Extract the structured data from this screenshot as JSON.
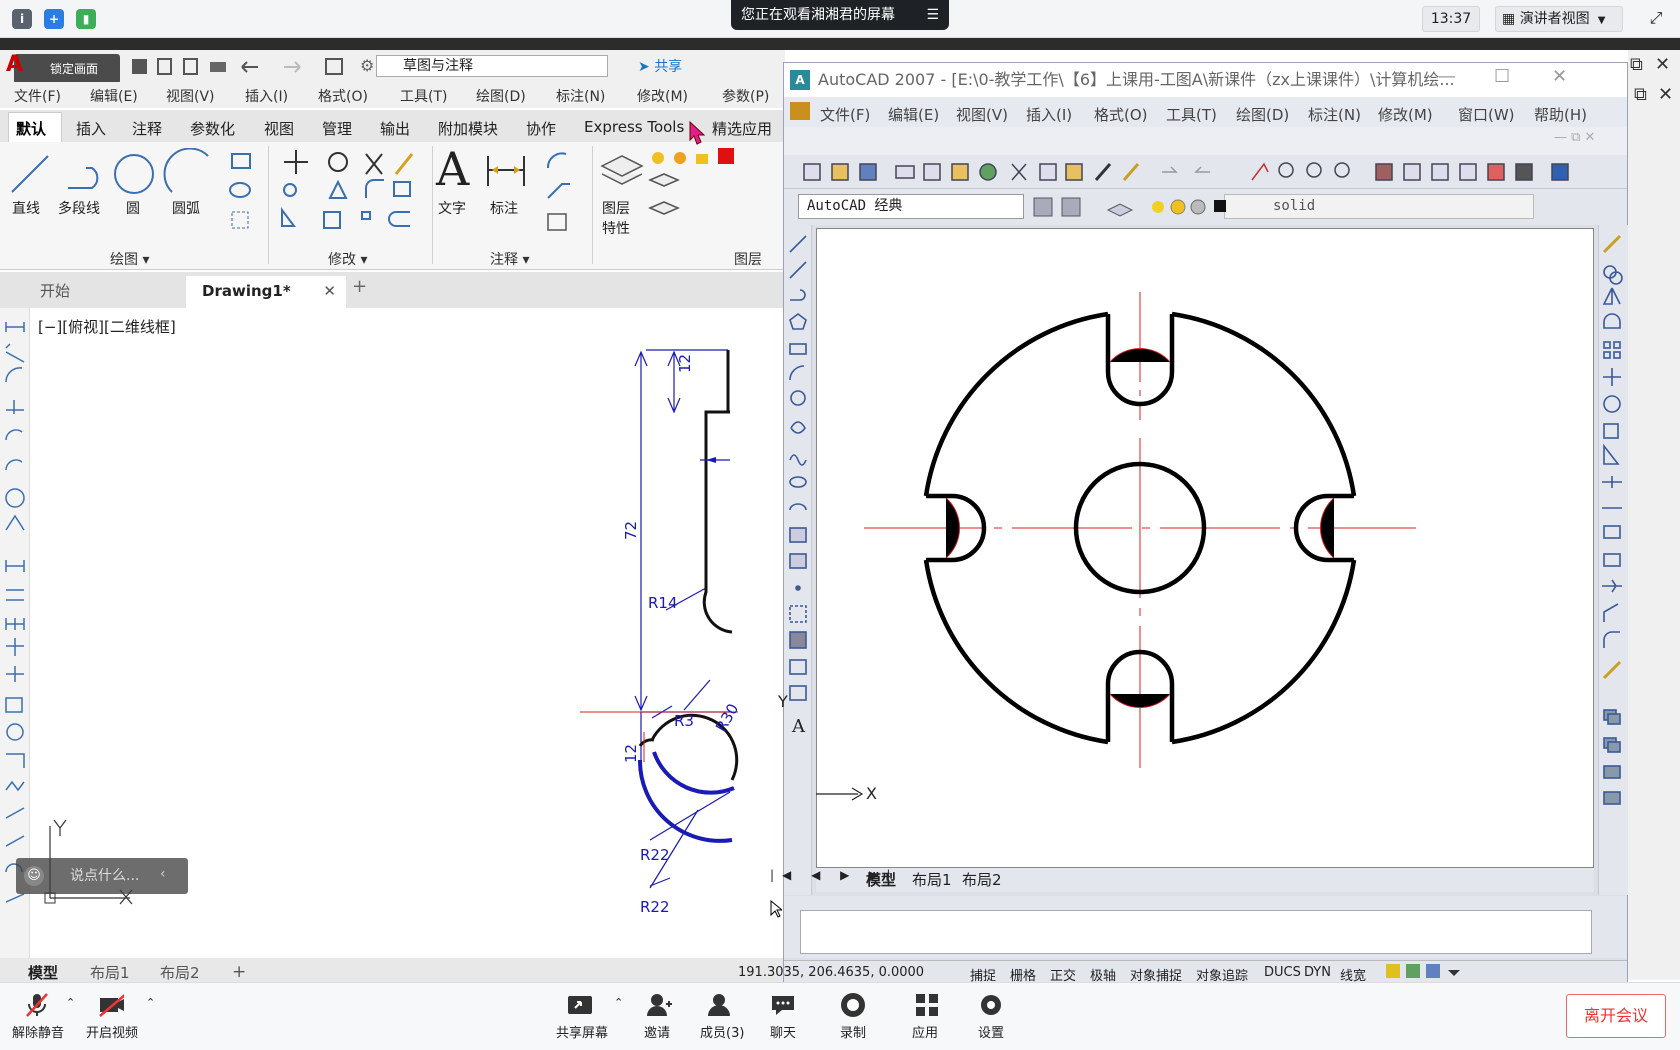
{
  "meeting": {
    "banner": "您正在观看湘湘君的屏幕",
    "clock": "13:37",
    "presenter_view": "演讲者视图",
    "lock_screen": "锁定画面",
    "chat_placeholder": "说点什么...",
    "bottom": {
      "unmute": "解除静音",
      "start_video": "开启视频",
      "share_screen": "共享屏幕",
      "invite": "邀请",
      "members": "成员(3)",
      "chat": "聊天",
      "record": "录制",
      "apps": "应用",
      "settings": "设置",
      "leave": "离开会议"
    }
  },
  "acad_left": {
    "workspace": "草图与注释",
    "share": "共享",
    "menu": [
      "文件(F)",
      "编辑(E)",
      "视图(V)",
      "插入(I)",
      "格式(O)",
      "工具(T)",
      "绘图(D)",
      "标注(N)",
      "修改(M)",
      "参数(P)"
    ],
    "ribbon_tabs": [
      "默认",
      "插入",
      "注释",
      "参数化",
      "视图",
      "管理",
      "输出",
      "附加模块",
      "协作",
      "Express Tools",
      "精选应用"
    ],
    "tools": {
      "line": "直线",
      "polyline": "多段线",
      "circle": "圆",
      "arc": "圆弧",
      "text": "文字",
      "dim": "标注",
      "layer": "图层",
      "props": "特性"
    },
    "panels": {
      "draw": "绘图",
      "modify": "修改",
      "annotate": "注释",
      "layer": "图层"
    },
    "doc_tabs": {
      "start": "开始",
      "drawing": "Drawing1*"
    },
    "view_label": "[−][俯视][二维线框]",
    "layout_tabs": [
      "模型",
      "布局1",
      "布局2"
    ],
    "dims": {
      "d12a": "12",
      "d72": "72",
      "d12b": "12",
      "r14": "R14",
      "r3": "R3",
      "r30": "R30",
      "r22a": "R22",
      "r22b": "R22"
    }
  },
  "acad_right": {
    "title": "AutoCAD 2007 - [E:\\0-教学工作\\【6】上课用-工图A\\新课件（zx上课课件）\\计算机绘...",
    "menu": [
      "文件(F)",
      "编辑(E)",
      "视图(V)",
      "插入(I)",
      "格式(O)",
      "工具(T)",
      "绘图(D)",
      "标注(N)",
      "修改(M)",
      "窗口(W)",
      "帮助(H)"
    ],
    "workspace": "AutoCAD 经典",
    "linetype": "solid",
    "layout_tabs": [
      "模型",
      "布局1",
      "布局2"
    ],
    "coords": "191.3035, 206.4635, 0.0000",
    "status": [
      "捕捉",
      "栅格",
      "正交",
      "极轴",
      "对象捕捉",
      "对象追踪",
      "DUCS",
      "DYN",
      "线宽"
    ],
    "axis_x": "X",
    "axis_y": "Y"
  },
  "colors": {
    "accent": "#1a73c9",
    "dim_blue": "#1a1ab4",
    "center_red": "#d42020",
    "leave_red": "#e33333"
  }
}
